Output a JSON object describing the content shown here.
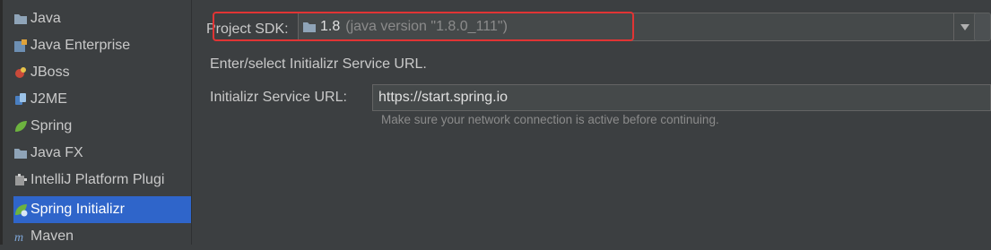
{
  "sidebar": {
    "items": [
      {
        "label": "Java",
        "icon": "folder-icon"
      },
      {
        "label": "Java Enterprise",
        "icon": "java-ee-icon"
      },
      {
        "label": "JBoss",
        "icon": "jboss-icon"
      },
      {
        "label": "J2ME",
        "icon": "j2me-icon"
      },
      {
        "label": "Spring",
        "icon": "spring-leaf-icon"
      },
      {
        "label": "Java FX",
        "icon": "folder-icon"
      },
      {
        "label": "IntelliJ Platform Plugi",
        "icon": "plugin-icon"
      },
      {
        "label": "Spring Initializr",
        "icon": "spring-initializr-icon",
        "selected": true
      },
      {
        "label": "Maven",
        "icon": "maven-icon"
      }
    ]
  },
  "sdk": {
    "label": "Project SDK:",
    "value": "1.8",
    "detail": "(java version \"1.8.0_111\")",
    "icon": "folder-icon"
  },
  "instructions": "Enter/select Initializr Service URL.",
  "service_url": {
    "label": "Initializr Service URL:",
    "value": "https://start.spring.io",
    "hint": "Make sure your network connection is active before continuing."
  },
  "colors": {
    "background": "#3c3f41",
    "selection": "#2f65ca",
    "highlight_box": "#e13434",
    "field_bg": "#45494a"
  }
}
